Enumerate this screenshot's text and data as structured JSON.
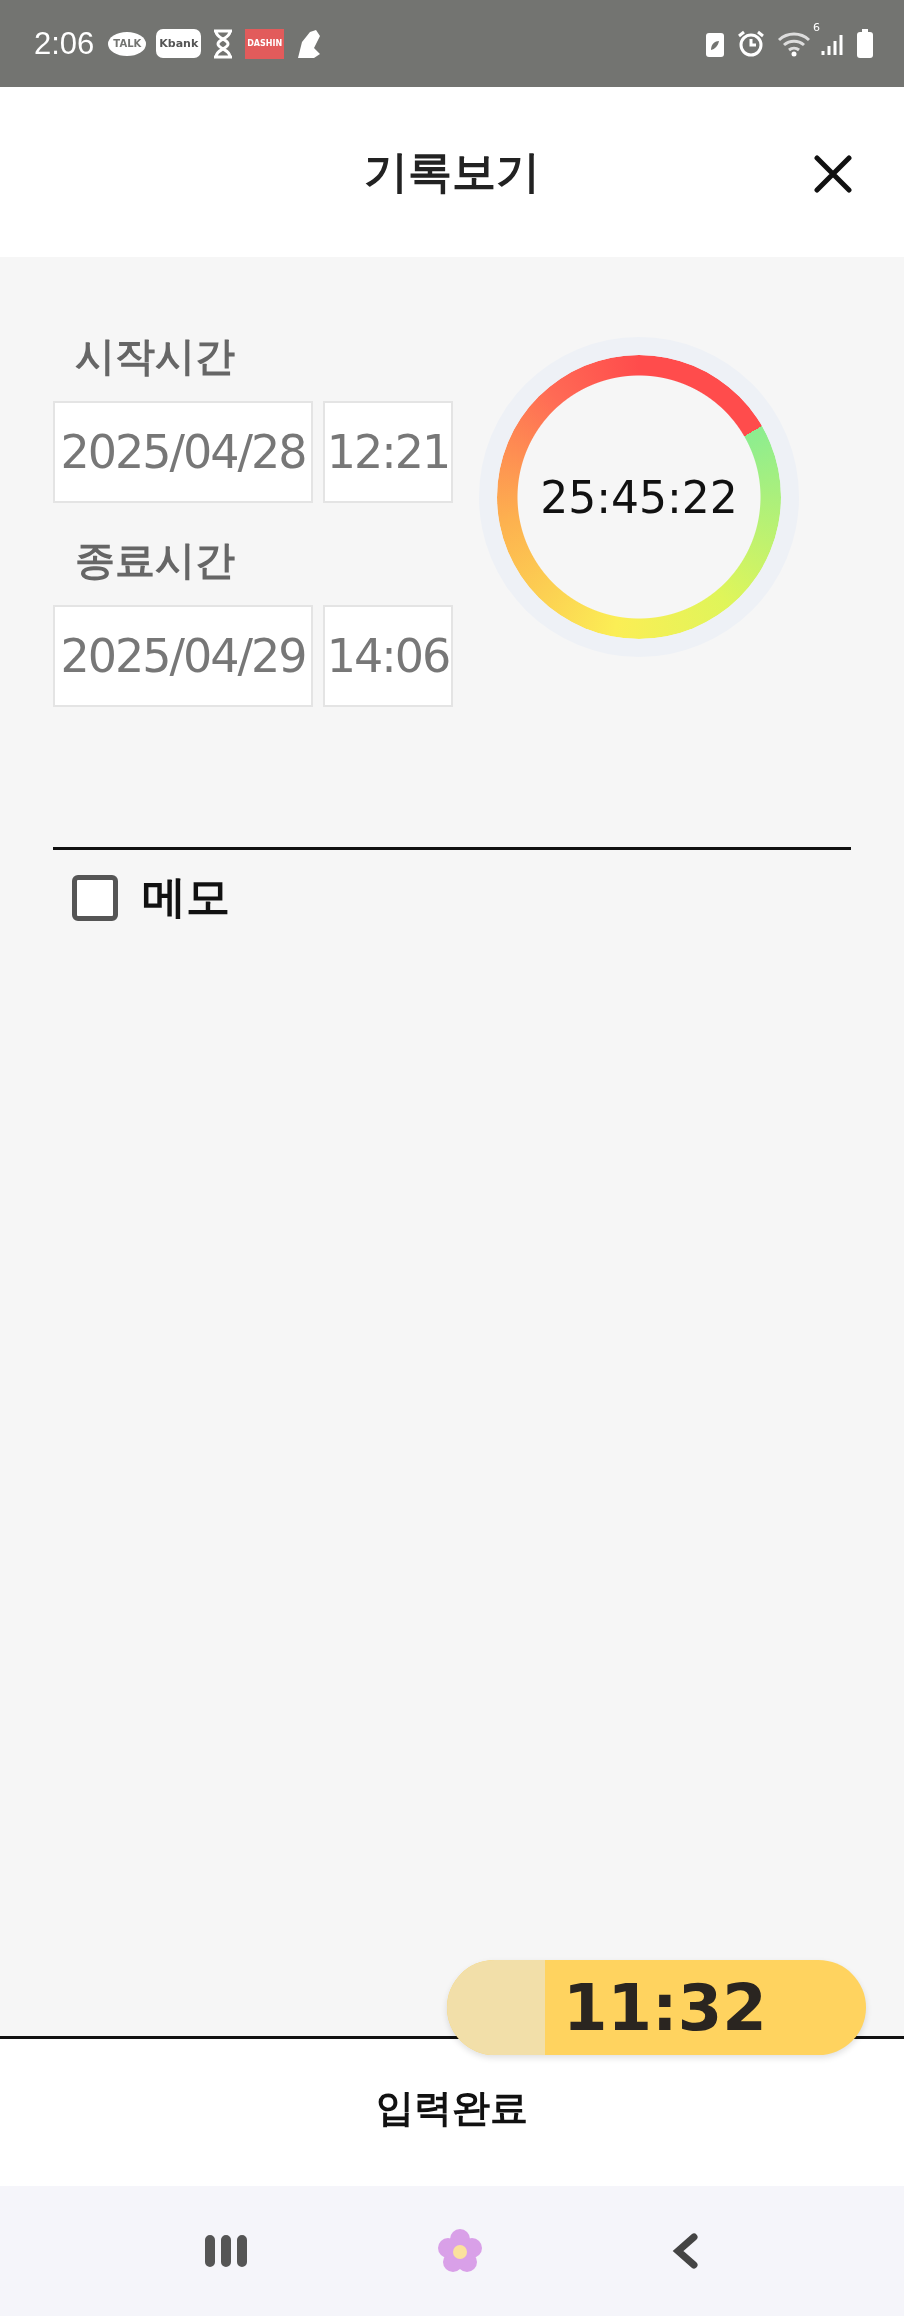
{
  "status_bar": {
    "time": "2:06",
    "app_icons": [
      {
        "kind": "talk",
        "label": "TALK"
      },
      {
        "kind": "kbank",
        "label": "Kbank"
      },
      {
        "kind": "hourglass"
      },
      {
        "kind": "dashin",
        "label": "DASHIN"
      },
      {
        "kind": "shoe"
      }
    ],
    "wifi_label": "6"
  },
  "header": {
    "title": "기록보기"
  },
  "times": [
    {
      "label": "시작시간",
      "date": "2025/04/28",
      "time": "12:21"
    },
    {
      "label": "종료시간",
      "date": "2025/04/29",
      "time": "14:06"
    }
  ],
  "duration": "25:45:22",
  "memo": {
    "label": "메모",
    "checked": false
  },
  "submit": {
    "label": "입력완료"
  },
  "floating_timer": {
    "time": "11:32"
  }
}
